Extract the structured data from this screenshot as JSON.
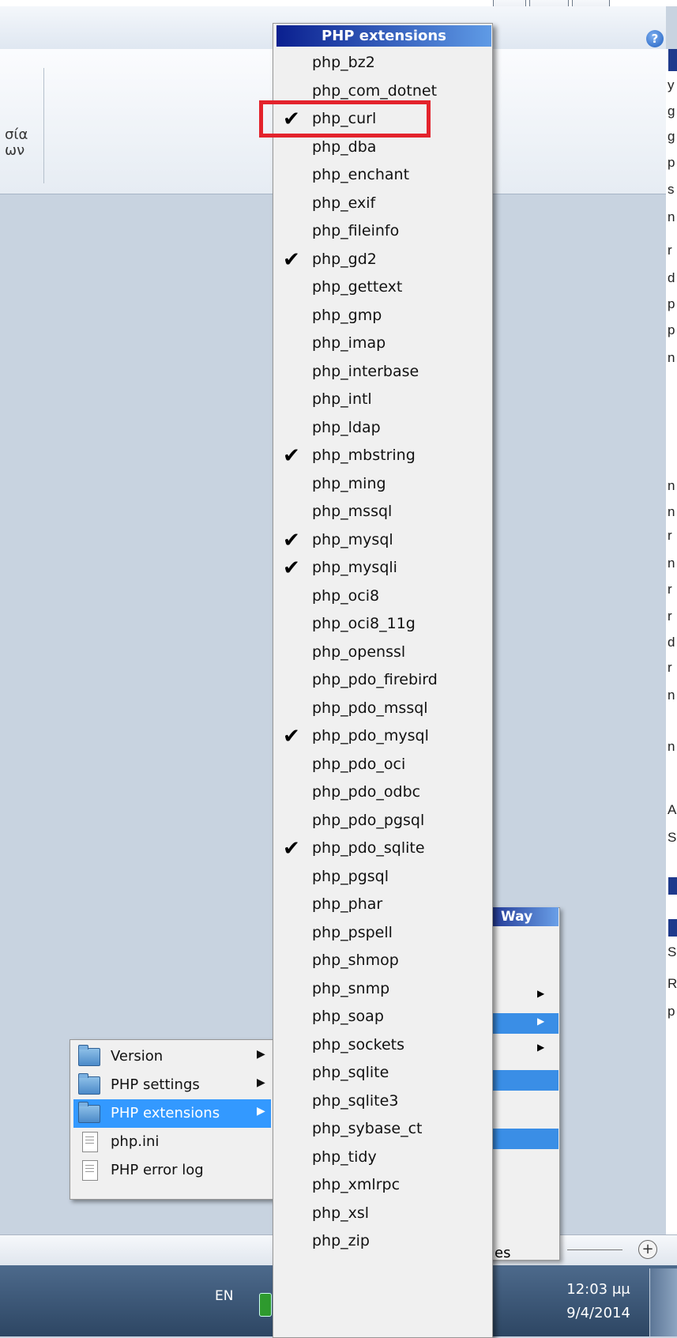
{
  "ribbon": {
    "text_line1": "σία",
    "text_line2": "ων"
  },
  "context_menu": {
    "items": [
      {
        "label": "Version",
        "icon": "folder-icon",
        "submenu": true,
        "selected": false
      },
      {
        "label": "PHP settings",
        "icon": "folder-icon",
        "submenu": true,
        "selected": false
      },
      {
        "label": "PHP extensions",
        "icon": "folder-icon",
        "submenu": true,
        "selected": true
      },
      {
        "label": "php.ini",
        "icon": "document-icon",
        "submenu": false,
        "selected": false
      },
      {
        "label": "PHP error log",
        "icon": "document-icon",
        "submenu": false,
        "selected": false
      }
    ]
  },
  "background_menu": {
    "title": "Way",
    "partial_label": "es"
  },
  "php_extensions_menu": {
    "title": "PHP extensions",
    "items": [
      {
        "label": "php_bz2",
        "checked": false
      },
      {
        "label": "php_com_dotnet",
        "checked": false
      },
      {
        "label": "php_curl",
        "checked": true
      },
      {
        "label": "php_dba",
        "checked": false
      },
      {
        "label": "php_enchant",
        "checked": false
      },
      {
        "label": "php_exif",
        "checked": false
      },
      {
        "label": "php_fileinfo",
        "checked": false
      },
      {
        "label": "php_gd2",
        "checked": true
      },
      {
        "label": "php_gettext",
        "checked": false
      },
      {
        "label": "php_gmp",
        "checked": false
      },
      {
        "label": "php_imap",
        "checked": false
      },
      {
        "label": "php_interbase",
        "checked": false
      },
      {
        "label": "php_intl",
        "checked": false
      },
      {
        "label": "php_ldap",
        "checked": false
      },
      {
        "label": "php_mbstring",
        "checked": true
      },
      {
        "label": "php_ming",
        "checked": false
      },
      {
        "label": "php_mssql",
        "checked": false
      },
      {
        "label": "php_mysql",
        "checked": true
      },
      {
        "label": "php_mysqli",
        "checked": true
      },
      {
        "label": "php_oci8",
        "checked": false
      },
      {
        "label": "php_oci8_11g",
        "checked": false
      },
      {
        "label": "php_openssl",
        "checked": false
      },
      {
        "label": "php_pdo_firebird",
        "checked": false
      },
      {
        "label": "php_pdo_mssql",
        "checked": false
      },
      {
        "label": "php_pdo_mysql",
        "checked": true
      },
      {
        "label": "php_pdo_oci",
        "checked": false
      },
      {
        "label": "php_pdo_odbc",
        "checked": false
      },
      {
        "label": "php_pdo_pgsql",
        "checked": false
      },
      {
        "label": "php_pdo_sqlite",
        "checked": true
      },
      {
        "label": "php_pgsql",
        "checked": false
      },
      {
        "label": "php_phar",
        "checked": false
      },
      {
        "label": "php_pspell",
        "checked": false
      },
      {
        "label": "php_shmop",
        "checked": false
      },
      {
        "label": "php_snmp",
        "checked": false
      },
      {
        "label": "php_soap",
        "checked": false
      },
      {
        "label": "php_sockets",
        "checked": false
      },
      {
        "label": "php_sqlite",
        "checked": false
      },
      {
        "label": "php_sqlite3",
        "checked": false
      },
      {
        "label": "php_sybase_ct",
        "checked": false
      },
      {
        "label": "php_tidy",
        "checked": false
      },
      {
        "label": "php_xmlrpc",
        "checked": false
      },
      {
        "label": "php_xsl",
        "checked": false
      },
      {
        "label": "php_zip",
        "checked": false
      }
    ],
    "annotated_item": "php_curl",
    "annotation_color": "#e3232c"
  },
  "taskbar": {
    "language": "EN",
    "time": "12:03 μμ",
    "date": "9/4/2014"
  },
  "statusbar": {
    "zoom_icon": "zoom-in-icon",
    "zoom_symbol": "+"
  },
  "right_edge_glyphs": [
    "y",
    "g",
    "g",
    "p",
    "s",
    "n",
    "r",
    "d",
    "p",
    "p",
    "n",
    "n",
    "n",
    "r",
    "n",
    "r",
    "r",
    "d",
    "r",
    "n",
    "n",
    "A",
    "S",
    "S",
    "R",
    "p"
  ],
  "colors": {
    "accent": "#3399ff",
    "menu_title": "#0a1f8f",
    "taskbar": "#3b5678"
  }
}
